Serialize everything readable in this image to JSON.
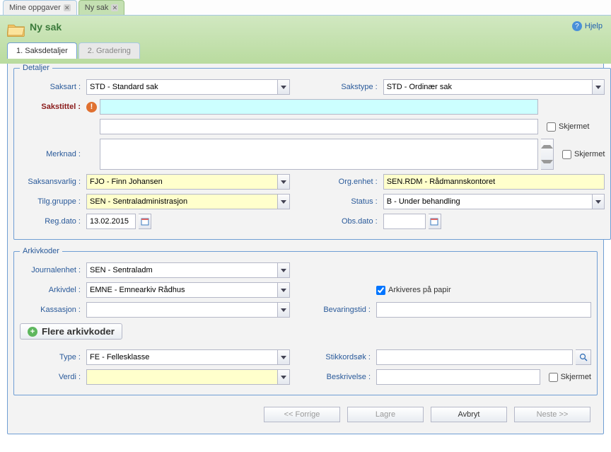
{
  "outer_tabs": [
    {
      "label": "Mine oppgaver",
      "active": false
    },
    {
      "label": "Ny sak",
      "active": true
    }
  ],
  "page": {
    "title": "Ny sak",
    "help": "Hjelp"
  },
  "inner_tabs": [
    {
      "label": "1. Saksdetaljer",
      "active": true
    },
    {
      "label": "2. Gradering",
      "active": false
    }
  ],
  "detaljer": {
    "legend": "Detaljer",
    "saksart": {
      "label": "Saksart :",
      "value": "STD - Standard sak"
    },
    "sakstype": {
      "label": "Sakstype :",
      "value": "STD - Ordinær sak"
    },
    "sakstittel": {
      "label": "Sakstittel :",
      "value": ""
    },
    "line2": {
      "value": "",
      "skjermet": "Skjermet"
    },
    "merknad": {
      "label": "Merknad :",
      "value": "",
      "skjermet": "Skjermet"
    },
    "saksansvarlig": {
      "label": "Saksansvarlig :",
      "value": "FJO - Finn Johansen"
    },
    "org_enhet": {
      "label": "Org.enhet :",
      "value": "SEN.RDM - Rådmannskontoret"
    },
    "tilg_gruppe": {
      "label": "Tilg.gruppe :",
      "value": "SEN - Sentraladministrasjon"
    },
    "status": {
      "label": "Status :",
      "value": "B - Under behandling"
    },
    "reg_dato": {
      "label": "Reg.dato :",
      "value": "13.02.2015"
    },
    "obs_dato": {
      "label": "Obs.dato :",
      "value": ""
    }
  },
  "arkivkoder": {
    "legend": "Arkivkoder",
    "journalenhet": {
      "label": "Journalenhet :",
      "value": "SEN - Sentraladm"
    },
    "arkivdel": {
      "label": "Arkivdel :",
      "value": "EMNE - Emnearkiv Rådhus"
    },
    "arkiveres_papir": {
      "label": "Arkiveres på papir",
      "checked": true
    },
    "kassasjon": {
      "label": "Kassasjon :",
      "value": ""
    },
    "bevaringstid": {
      "label": "Bevaringstid :",
      "value": ""
    },
    "flere": "Flere arkivkoder",
    "type": {
      "label": "Type :",
      "value": "FE - Fellesklasse"
    },
    "stikkordsok": {
      "label": "Stikkordsøk :",
      "value": ""
    },
    "verdi": {
      "label": "Verdi :",
      "value": ""
    },
    "beskrivelse": {
      "label": "Beskrivelse :",
      "value": "",
      "skjermet": "Skjermet"
    }
  },
  "footer": {
    "forrige": "<< Forrige",
    "lagre": "Lagre",
    "avbryt": "Avbryt",
    "neste": "Neste >>"
  }
}
